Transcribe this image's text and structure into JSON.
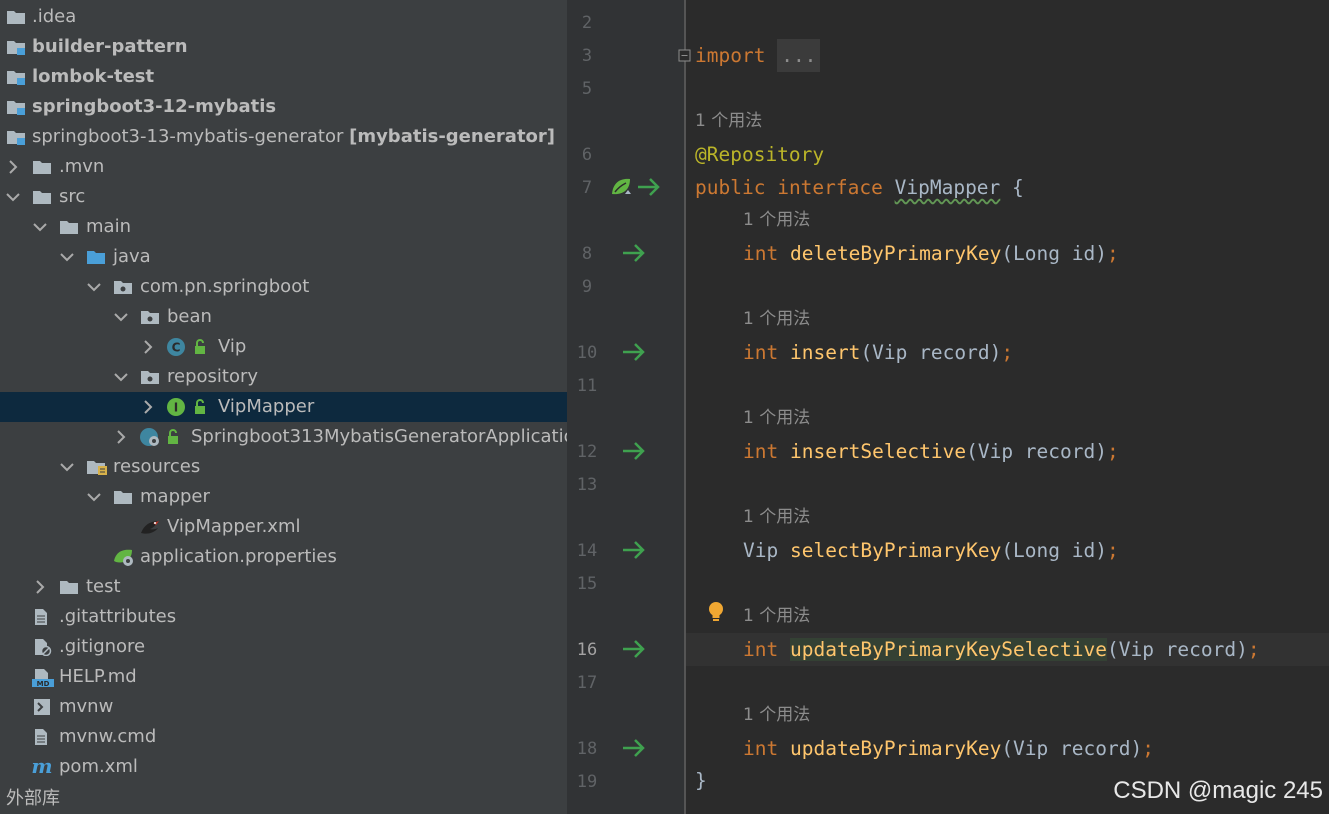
{
  "project_tree": {
    "items": [
      {
        "id": "idea",
        "label": ".idea"
      },
      {
        "id": "builder",
        "label": "builder-pattern"
      },
      {
        "id": "lombok",
        "label": "lombok-test"
      },
      {
        "id": "sb12",
        "label": "springboot3-12-mybatis"
      },
      {
        "id": "sb13",
        "label": "springboot3-13-mybatis-generator",
        "suffix": "[mybatis-generator]"
      },
      {
        "id": "mvn",
        "label": ".mvn"
      },
      {
        "id": "src",
        "label": "src"
      },
      {
        "id": "main",
        "label": "main"
      },
      {
        "id": "java",
        "label": "java"
      },
      {
        "id": "pkg",
        "label": "com.pn.springboot"
      },
      {
        "id": "bean",
        "label": "bean"
      },
      {
        "id": "vip",
        "label": "Vip"
      },
      {
        "id": "repository",
        "label": "repository"
      },
      {
        "id": "vipmapper",
        "label": "VipMapper"
      },
      {
        "id": "app",
        "label": "Springboot313MybatisGeneratorApplicatio"
      },
      {
        "id": "resources",
        "label": "resources"
      },
      {
        "id": "mapper",
        "label": "mapper"
      },
      {
        "id": "vipmapperxml",
        "label": "VipMapper.xml"
      },
      {
        "id": "appprops",
        "label": "application.properties"
      },
      {
        "id": "test",
        "label": "test"
      },
      {
        "id": "gitattr",
        "label": ".gitattributes"
      },
      {
        "id": "gitignore",
        "label": ".gitignore"
      },
      {
        "id": "help",
        "label": "HELP.md"
      },
      {
        "id": "mvnw",
        "label": "mvnw"
      },
      {
        "id": "mvnwcmd",
        "label": "mvnw.cmd"
      },
      {
        "id": "pom",
        "label": "pom.xml"
      }
    ],
    "external_libraries": "外部库"
  },
  "editor": {
    "line_numbers": [
      "2",
      "3",
      "5",
      "6",
      "7",
      "8",
      "9",
      "10",
      "11",
      "12",
      "13",
      "14",
      "15",
      "16",
      "17",
      "18",
      "19"
    ],
    "usage_hint": "1 个用法",
    "code": {
      "import_kw": "import",
      "import_fold": "...",
      "annotation": "@Repository",
      "public_kw": "public",
      "interface_kw": "interface",
      "interface_name": "VipMapper",
      "open_brace": "{",
      "close_brace": "}",
      "methods": [
        {
          "ret": "int",
          "name": "deleteByPrimaryKey",
          "params": "(Long id)",
          "end": ";"
        },
        {
          "ret": "int",
          "name": "insert",
          "params": "(Vip record)",
          "end": ";"
        },
        {
          "ret": "int",
          "name": "insertSelective",
          "params": "(Vip record)",
          "end": ";"
        },
        {
          "ret": "Vip",
          "name": "selectByPrimaryKey",
          "params": "(Long id)",
          "end": ";"
        },
        {
          "ret": "int",
          "name": "updateByPrimaryKeySelective",
          "params": "(Vip record)",
          "end": ";"
        },
        {
          "ret": "int",
          "name": "updateByPrimaryKey",
          "params": "(Vip record)",
          "end": ";"
        }
      ]
    }
  },
  "watermark": "CSDN @magic 245",
  "colors": {
    "tree_bg": "#3c3f41",
    "selection": "#0d293e",
    "editor_bg": "#2b2b2b",
    "gutter_bg": "#313335",
    "keyword": "#cc7832",
    "method": "#ffc66d",
    "annotation": "#bbb529",
    "text": "#a9b7c6",
    "arrow": "#3fa14f"
  }
}
